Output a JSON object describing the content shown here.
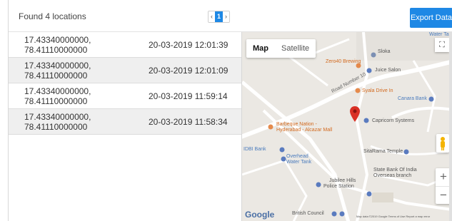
{
  "header": {
    "found_text": "Found 4 locations",
    "export_label": "Export Data"
  },
  "pagination": {
    "prev": "‹",
    "current": "1",
    "next": "›"
  },
  "locations": [
    {
      "coords": "17.43340000000, 78.41110000000",
      "time": "20-03-2019 12:01:39"
    },
    {
      "coords": "17.43340000000, 78.41110000000",
      "time": "20-03-2019 12:01:09"
    },
    {
      "coords": "17.43340000000, 78.41110000000",
      "time": "20-03-2019 11:59:14"
    },
    {
      "coords": "17.43340000000, 78.41110000000",
      "time": "20-03-2019 11:58:34"
    }
  ],
  "map": {
    "tab_map": "Map",
    "tab_satellite": "Satellite",
    "zoom_in": "+",
    "zoom_out": "−",
    "fullscreen_icon": "⛶",
    "google_logo": "Google",
    "attribution": "Map data ©2019 Google   Terms of Use   Report a map error",
    "labels": {
      "water_tank_top": "Water Tank",
      "sloka": "Sloka",
      "zero40": "Zero40 Brewing",
      "juice_salon": "Juice Salon",
      "syala": "Syala Drive In",
      "canara": "Canara Bank",
      "capricorn": "Capricorn Systems",
      "barbeque_1": "Barbeque Nation -",
      "barbeque_2": "Hyderabad - Alcazar Mall",
      "idbi": "IDBI Bank",
      "sitarama": "SitaRama Temple",
      "overhead_1": "Overhead",
      "overhead_2": "Water Tank",
      "sbi_1": "State Bank Of India",
      "sbi_2": "Overseas branch",
      "jubilee_1": "Jubilee Hills",
      "jubilee_2": "Police Station",
      "british": "British Council",
      "road_10": "Road Number 10"
    }
  },
  "colors": {
    "accent": "#1e88e5",
    "row_alt": "#efefef",
    "map_bg": "#ebe8e3",
    "pin": "#d93025"
  }
}
